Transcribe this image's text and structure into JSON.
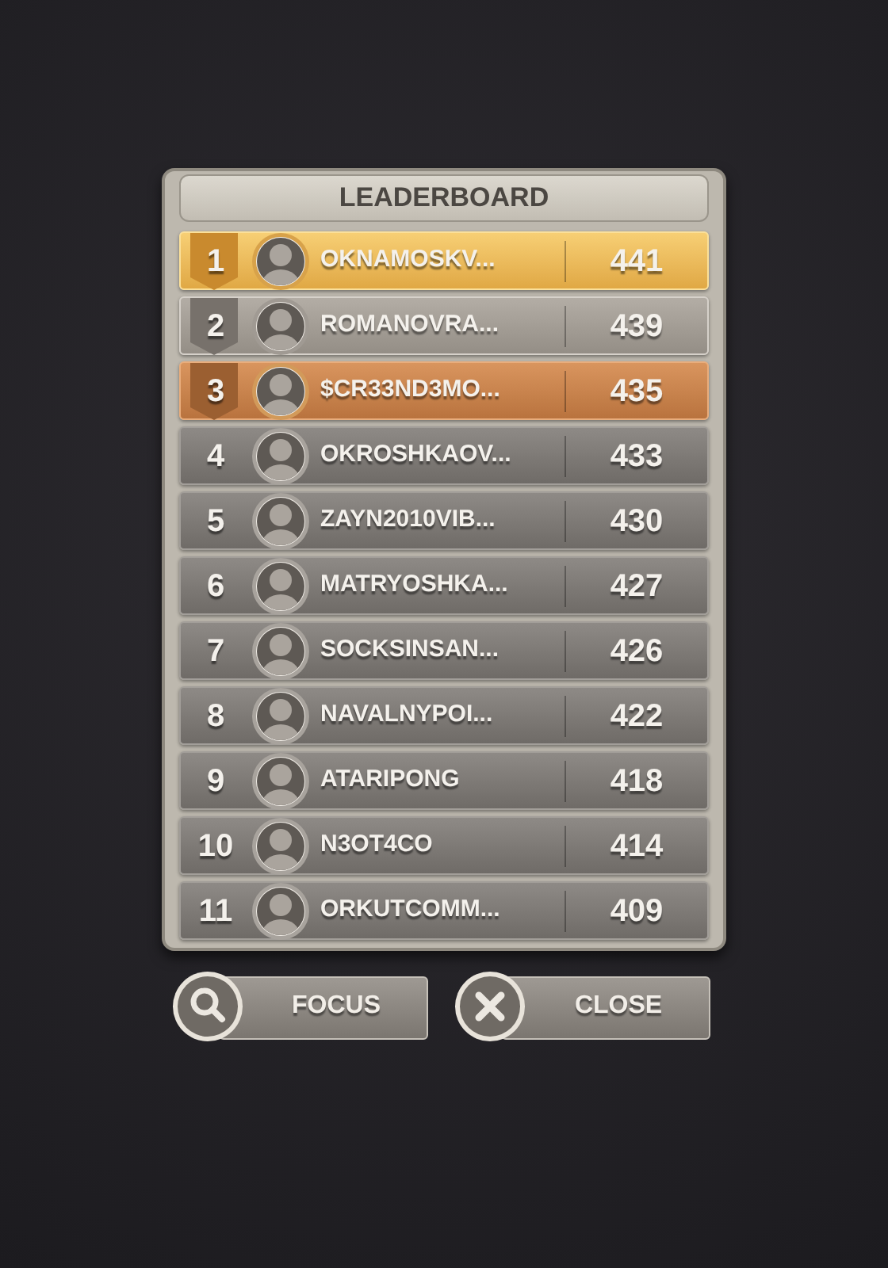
{
  "title": "LEADERBOARD",
  "rows": [
    {
      "rank": "1",
      "name": "OKNAMOSKV...",
      "score": "441",
      "kind": "gold"
    },
    {
      "rank": "2",
      "name": "ROMANOVRA...",
      "score": "439",
      "kind": "silver"
    },
    {
      "rank": "3",
      "name": "$CR33ND3MO...",
      "score": "435",
      "kind": "bronze"
    },
    {
      "rank": "4",
      "name": "OKROSHKAOV...",
      "score": "433",
      "kind": "plain"
    },
    {
      "rank": "5",
      "name": "ZAYN2010VIB...",
      "score": "430",
      "kind": "plain"
    },
    {
      "rank": "6",
      "name": "MATRYOSHKA...",
      "score": "427",
      "kind": "plain"
    },
    {
      "rank": "7",
      "name": "SOCKSINSAN...",
      "score": "426",
      "kind": "plain"
    },
    {
      "rank": "8",
      "name": "NAVALNYPOI...",
      "score": "422",
      "kind": "plain"
    },
    {
      "rank": "9",
      "name": "ATARIPONG",
      "score": "418",
      "kind": "plain"
    },
    {
      "rank": "10",
      "name": "N3OT4CO",
      "score": "414",
      "kind": "plain"
    },
    {
      "rank": "11",
      "name": "ORKUTCOMM...",
      "score": "409",
      "kind": "plain"
    }
  ],
  "buttons": [
    {
      "label": "FOCUS",
      "kind": "search"
    },
    {
      "label": "CLOSE",
      "kind": "close"
    }
  ]
}
